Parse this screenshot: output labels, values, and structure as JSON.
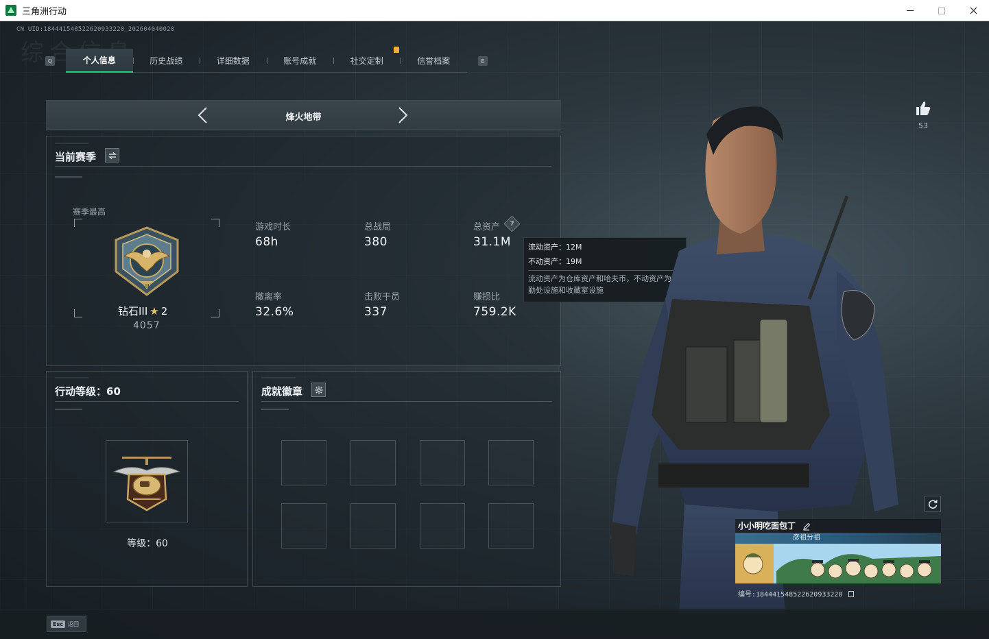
{
  "window": {
    "title": "三角洲行动",
    "minimize": "—",
    "maximize": "☐",
    "close": "✕"
  },
  "uid_line": "CN UID:18444154852262093322​0_202604040020",
  "watermark": "综合信息",
  "tabs": {
    "left_key": "Q",
    "right_key": "E",
    "items": [
      {
        "label": "个人信息",
        "active": true
      },
      {
        "label": "历史战绩",
        "active": false
      },
      {
        "label": "详细数据",
        "active": false
      },
      {
        "label": "账号成就",
        "active": false
      },
      {
        "label": "社交定制",
        "active": false
      },
      {
        "label": "信誉档案",
        "active": false
      }
    ]
  },
  "mode": {
    "title": "烽火地带"
  },
  "season": {
    "title": "当前赛季",
    "peak_label": "赛季最高",
    "rank_name": "钻石III",
    "rank_stars": "2",
    "rank_score": "4057",
    "stats": [
      {
        "label": "游戏时长",
        "value": "68h"
      },
      {
        "label": "总战局",
        "value": "380"
      },
      {
        "label": "总资产",
        "value": "31.1M"
      },
      {
        "label": "撤离率",
        "value": "32.6%"
      },
      {
        "label": "击败干员",
        "value": "337"
      },
      {
        "label": "赚损比",
        "value": "759.2K"
      }
    ]
  },
  "tooltip": {
    "liquid": "流动资产：12M",
    "fixed": "不动资产：19M",
    "desc": "流动资产为仓库资产和哈夫币，不动资产为特勤处设施和收藏室设施"
  },
  "level": {
    "title": "行动等级：60",
    "label": "等级：60"
  },
  "badges": {
    "title": "成就徽章",
    "slots": 8
  },
  "likes": {
    "count": "53"
  },
  "profile": {
    "name": "小小明吃面包丁",
    "group": "彦祖分祖",
    "serial": "编号:1844415485226209332​20"
  },
  "footer": {
    "esc_key": "Esc",
    "esc_label": "返回"
  },
  "colors": {
    "accent": "#22d17f",
    "tab_alert": "#e8b33a",
    "background": "#1a2126"
  }
}
